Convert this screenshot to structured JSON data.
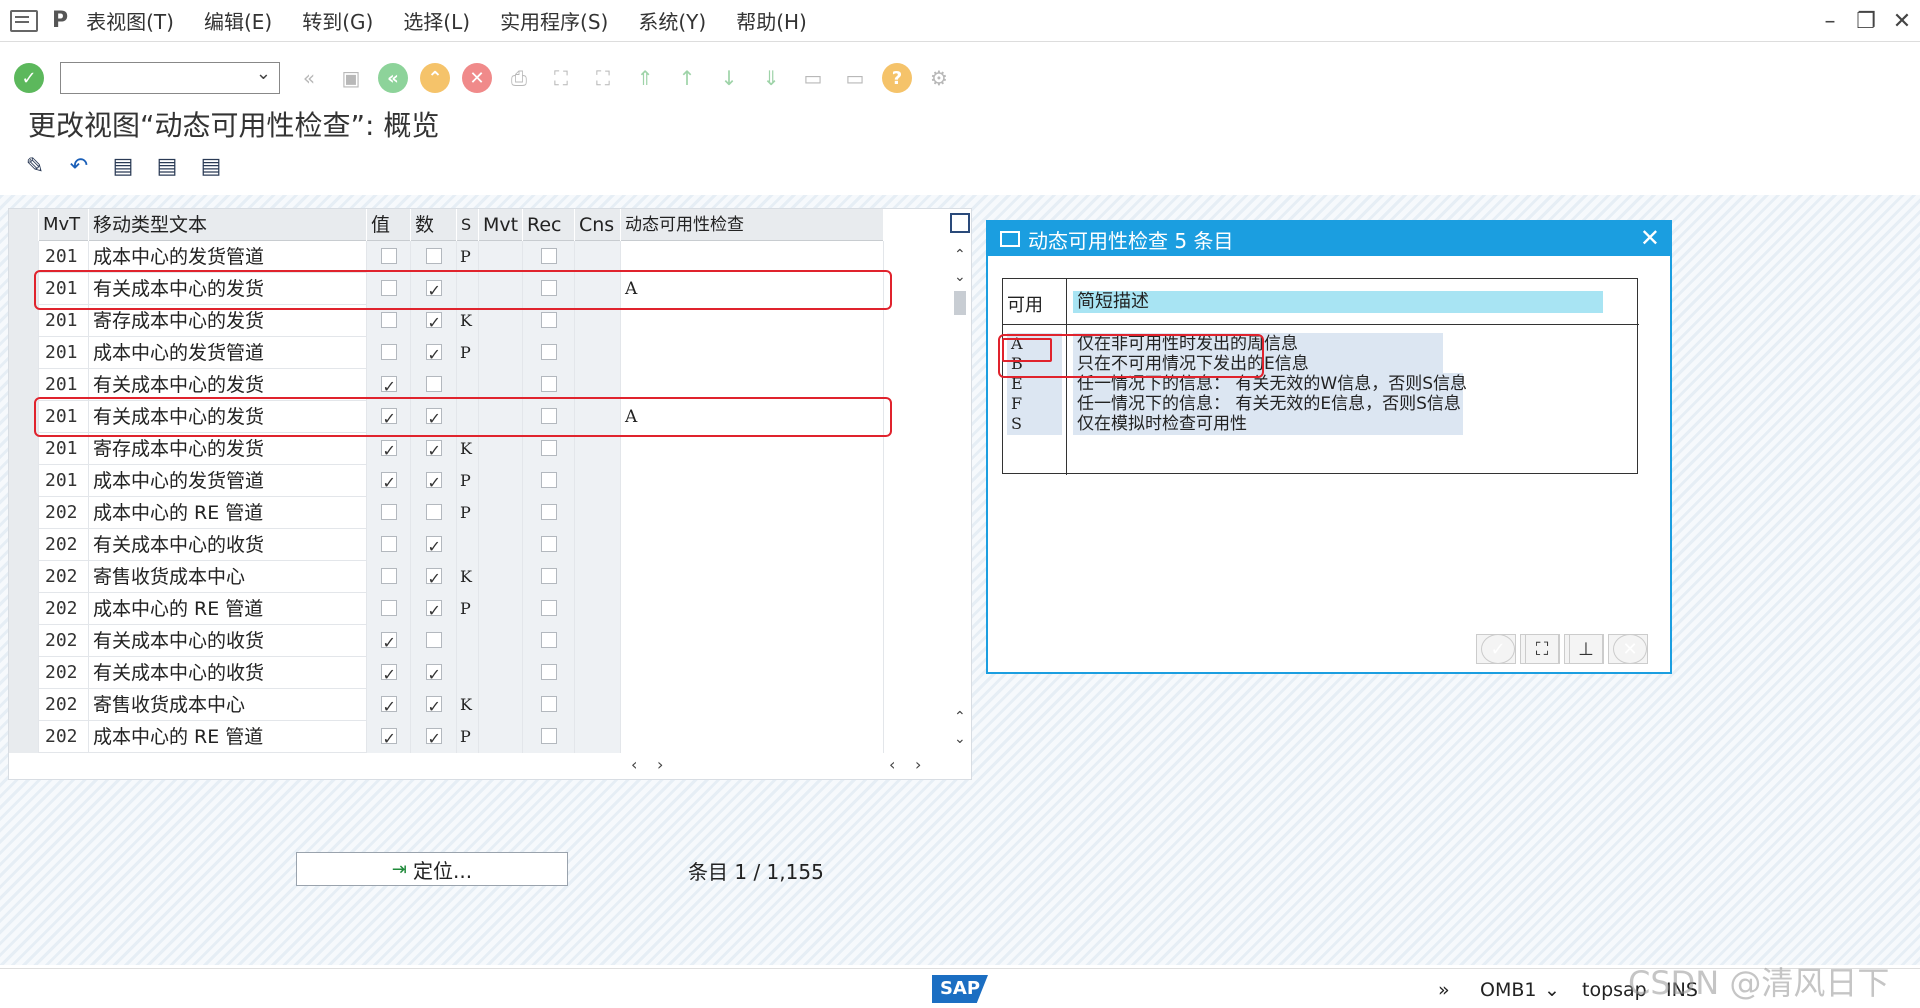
{
  "menu": {
    "items": [
      "表视图(T)",
      "编辑(E)",
      "转到(G)",
      "选择(L)",
      "实用程序(S)",
      "系统(Y)",
      "帮助(H)"
    ]
  },
  "title": "更改视图“动态可用性检查”: 概览",
  "table": {
    "columns": [
      "MvT",
      "移动类型文本",
      "值",
      "数",
      "S",
      "Mvt",
      "Rec",
      "Cns",
      "动态可用性检查"
    ],
    "rows": [
      {
        "mvt": "201",
        "text": "成本中心的发货管道",
        "val": false,
        "num": false,
        "s": "P",
        "dyn": ""
      },
      {
        "mvt": "201",
        "text": "有关成本中心的发货",
        "val": false,
        "num": true,
        "s": "",
        "dyn": "A"
      },
      {
        "mvt": "201",
        "text": "寄存成本中心的发货",
        "val": false,
        "num": true,
        "s": "K",
        "dyn": ""
      },
      {
        "mvt": "201",
        "text": "成本中心的发货管道",
        "val": false,
        "num": true,
        "s": "P",
        "dyn": ""
      },
      {
        "mvt": "201",
        "text": "有关成本中心的发货",
        "val": true,
        "num": false,
        "s": "",
        "dyn": ""
      },
      {
        "mvt": "201",
        "text": "有关成本中心的发货",
        "val": true,
        "num": true,
        "s": "",
        "dyn": "A"
      },
      {
        "mvt": "201",
        "text": "寄存成本中心的发货",
        "val": true,
        "num": true,
        "s": "K",
        "dyn": ""
      },
      {
        "mvt": "201",
        "text": "成本中心的发货管道",
        "val": true,
        "num": true,
        "s": "P",
        "dyn": ""
      },
      {
        "mvt": "202",
        "text": "成本中心的 RE 管道",
        "val": false,
        "num": false,
        "s": "P",
        "dyn": ""
      },
      {
        "mvt": "202",
        "text": "有关成本中心的收货",
        "val": false,
        "num": true,
        "s": "",
        "dyn": ""
      },
      {
        "mvt": "202",
        "text": "寄售收货成本中心",
        "val": false,
        "num": true,
        "s": "K",
        "dyn": ""
      },
      {
        "mvt": "202",
        "text": "成本中心的 RE 管道",
        "val": false,
        "num": true,
        "s": "P",
        "dyn": ""
      },
      {
        "mvt": "202",
        "text": "有关成本中心的收货",
        "val": true,
        "num": false,
        "s": "",
        "dyn": ""
      },
      {
        "mvt": "202",
        "text": "有关成本中心的收货",
        "val": true,
        "num": true,
        "s": "",
        "dyn": ""
      },
      {
        "mvt": "202",
        "text": "寄售收货成本中心",
        "val": true,
        "num": true,
        "s": "K",
        "dyn": ""
      },
      {
        "mvt": "202",
        "text": "成本中心的 RE 管道",
        "val": true,
        "num": true,
        "s": "P",
        "dyn": ""
      }
    ]
  },
  "dialog": {
    "title": "动态可用性检查 5 条目",
    "col_key": "可用",
    "col_desc": "简短描述",
    "entries": [
      {
        "key": "A",
        "desc": "仅在非可用性时发出的周信息"
      },
      {
        "key": "B",
        "desc": "只在不可用情况下发出的E信息"
      },
      {
        "key": "E",
        "desc": "任一情况下的信息： 有关无效的W信息，否则S信息"
      },
      {
        "key": "F",
        "desc": "任一情况下的信息： 有关无效的E信息，否则S信息"
      },
      {
        "key": "S",
        "desc": "仅在模拟时检查可用性"
      }
    ]
  },
  "position_button": "定位...",
  "entry_label": "条目",
  "entry_count": "1 / 1,155",
  "status": {
    "system": "OMB1",
    "server": "topsap",
    "mode": "INS",
    "logo": "SAP"
  },
  "watermark": "CSDN @清风日下"
}
